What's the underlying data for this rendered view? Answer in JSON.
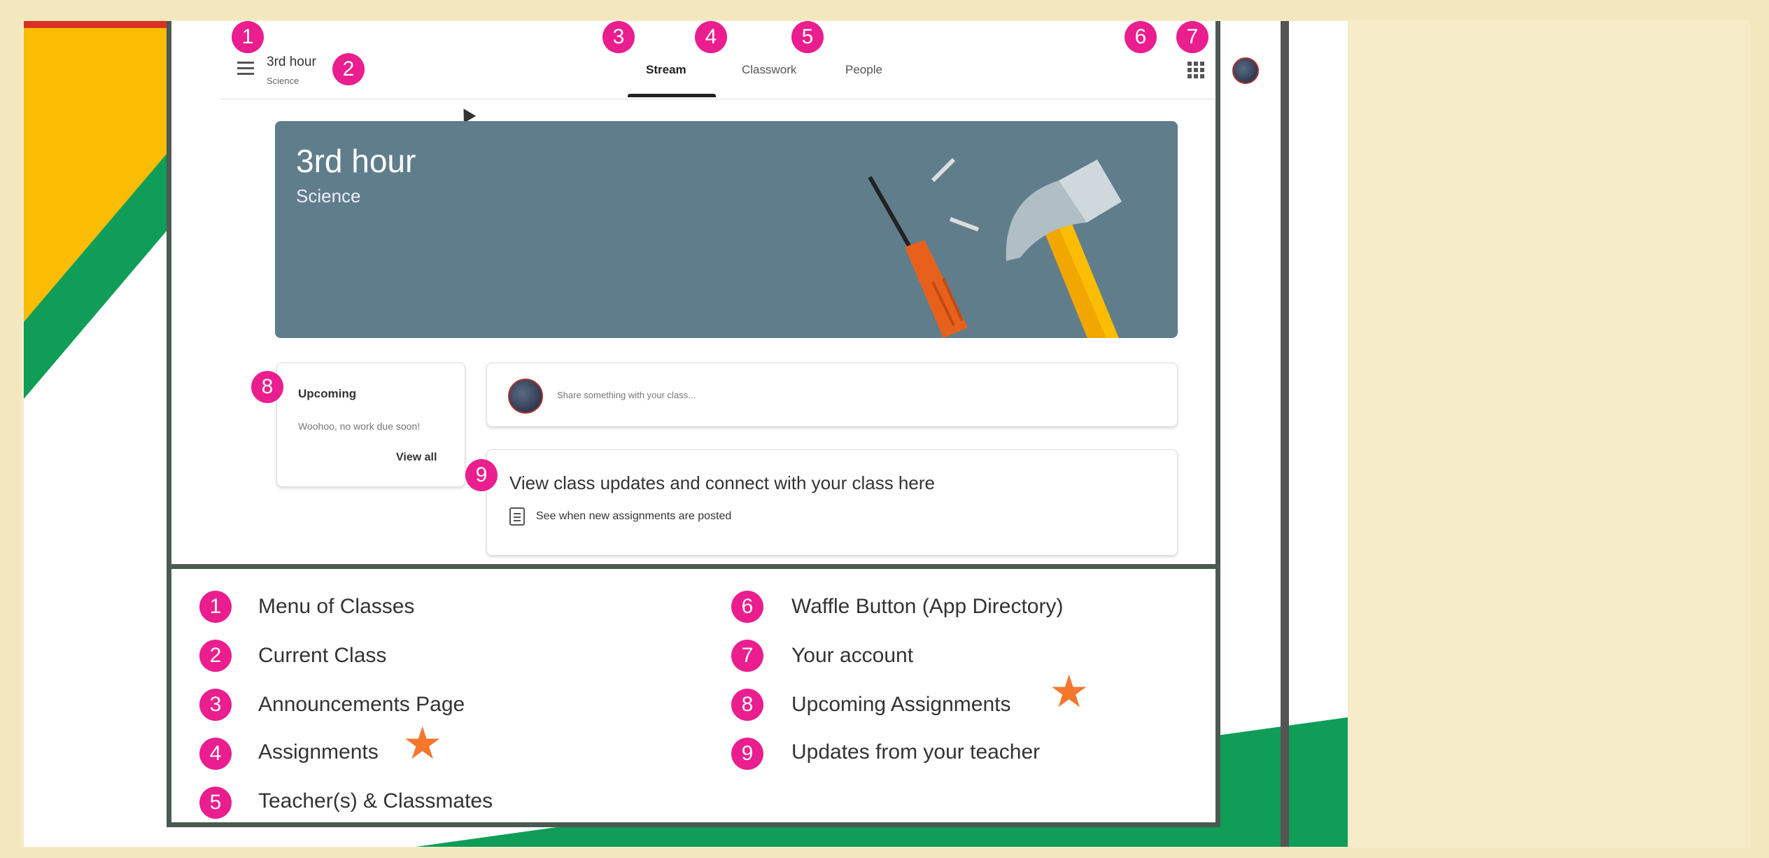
{
  "topbar": {
    "class_name": "3rd hour",
    "class_subject": "Science",
    "tabs": [
      {
        "label": "Stream",
        "active": true
      },
      {
        "label": "Classwork",
        "active": false
      },
      {
        "label": "People",
        "active": false
      }
    ]
  },
  "banner": {
    "title": "3rd hour",
    "subtitle": "Science"
  },
  "upcoming": {
    "title": "Upcoming",
    "text": "Woohoo, no work due soon!",
    "view_all": "View all"
  },
  "share": {
    "placeholder": "Share something with your class..."
  },
  "updates": {
    "title": "View class updates and connect with your class here",
    "subtitle": "See when new assignments are posted"
  },
  "badges": [
    "1",
    "2",
    "3",
    "4",
    "5",
    "6",
    "7",
    "8",
    "9"
  ],
  "legend": [
    {
      "num": "1",
      "label": "Menu of Classes"
    },
    {
      "num": "2",
      "label": "Current Class"
    },
    {
      "num": "3",
      "label": "Announcements Page"
    },
    {
      "num": "4",
      "label": "Assignments"
    },
    {
      "num": "5",
      "label": "Teacher(s) & Classmates"
    },
    {
      "num": "6",
      "label": "Waffle Button (App Directory)"
    },
    {
      "num": "7",
      "label": "Your account"
    },
    {
      "num": "8",
      "label": "Upcoming Assignments"
    },
    {
      "num": "9",
      "label": "Updates from your teacher"
    }
  ],
  "colors": {
    "badge": "#ea1e8e",
    "banner": "#607d8b",
    "star": "#f4772e",
    "google_yellow": "#fbbc04",
    "google_green": "#0f9d58",
    "google_red": "#d93025"
  },
  "icons": [
    "menu-icon",
    "apps-icon",
    "avatar-icon",
    "doc-icon",
    "star-icon",
    "screwdriver-icon",
    "hammer-icon",
    "screw-icon"
  ]
}
